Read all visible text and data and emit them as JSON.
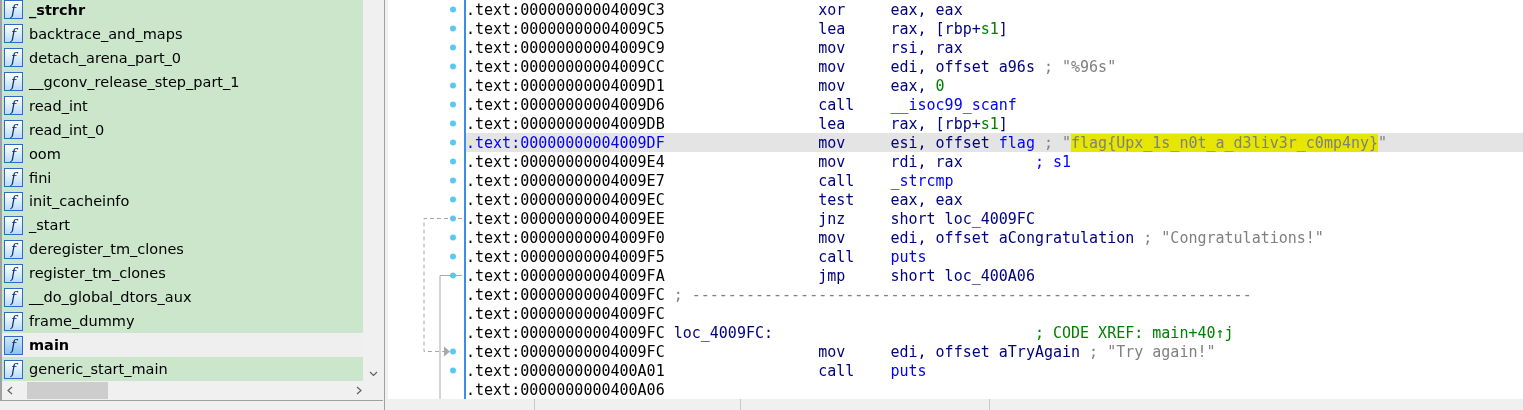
{
  "functions": {
    "items": [
      {
        "icon": "f",
        "name": "_strchr",
        "bold": true,
        "selected": false
      },
      {
        "icon": "f",
        "name": "backtrace_and_maps",
        "bold": false,
        "selected": false
      },
      {
        "icon": "f",
        "name": "detach_arena_part_0",
        "bold": false,
        "selected": false
      },
      {
        "icon": "f",
        "name": "__gconv_release_step_part_1",
        "bold": false,
        "selected": false
      },
      {
        "icon": "f",
        "name": "read_int",
        "bold": false,
        "selected": false
      },
      {
        "icon": "f",
        "name": "read_int_0",
        "bold": false,
        "selected": false
      },
      {
        "icon": "f",
        "name": "oom",
        "bold": false,
        "selected": false
      },
      {
        "icon": "f",
        "name": "fini",
        "bold": false,
        "selected": false
      },
      {
        "icon": "f",
        "name": "init_cacheinfo",
        "bold": false,
        "selected": false
      },
      {
        "icon": "f",
        "name": "_start",
        "bold": false,
        "selected": false
      },
      {
        "icon": "f",
        "name": "deregister_tm_clones",
        "bold": false,
        "selected": false
      },
      {
        "icon": "f",
        "name": "register_tm_clones",
        "bold": false,
        "selected": false
      },
      {
        "icon": "f",
        "name": "__do_global_dtors_aux",
        "bold": false,
        "selected": false
      },
      {
        "icon": "f",
        "name": "frame_dummy",
        "bold": false,
        "selected": false
      },
      {
        "icon": "f",
        "name": "main",
        "bold": true,
        "selected": true
      },
      {
        "icon": "f",
        "name": "generic_start_main",
        "bold": false,
        "selected": false
      }
    ]
  },
  "disassembly": {
    "lines": [
      {
        "kind": "code",
        "address": ".text:00000000004009C3",
        "selected": false,
        "mnemonic": "xor",
        "operands": [
          {
            "kind": "reg",
            "text": "eax, eax"
          }
        ]
      },
      {
        "kind": "code",
        "address": ".text:00000000004009C5",
        "selected": false,
        "mnemonic": "lea",
        "operands": [
          {
            "kind": "reg",
            "text": "rax, [rbp+"
          },
          {
            "kind": "num",
            "text": "s1"
          },
          {
            "kind": "reg",
            "text": "]"
          }
        ]
      },
      {
        "kind": "code",
        "address": ".text:00000000004009C9",
        "selected": false,
        "mnemonic": "mov",
        "operands": [
          {
            "kind": "reg",
            "text": "rsi, rax"
          }
        ]
      },
      {
        "kind": "code",
        "address": ".text:00000000004009CC",
        "selected": false,
        "mnemonic": "mov",
        "operands": [
          {
            "kind": "reg",
            "text": "edi, offset a96s"
          }
        ],
        "comment": [
          {
            "kind": "str",
            "text": "; \"%96s\""
          }
        ]
      },
      {
        "kind": "code",
        "address": ".text:00000000004009D1",
        "selected": false,
        "mnemonic": "mov",
        "operands": [
          {
            "kind": "reg",
            "text": "eax, "
          },
          {
            "kind": "num",
            "text": "0"
          }
        ]
      },
      {
        "kind": "code",
        "address": ".text:00000000004009D6",
        "selected": false,
        "mnemonic": "call",
        "operands": [
          {
            "kind": "name",
            "text": "__isoc99_scanf"
          }
        ]
      },
      {
        "kind": "code",
        "address": ".text:00000000004009DB",
        "selected": false,
        "mnemonic": "lea",
        "operands": [
          {
            "kind": "reg",
            "text": "rax, [rbp+"
          },
          {
            "kind": "num",
            "text": "s1"
          },
          {
            "kind": "reg",
            "text": "]"
          }
        ]
      },
      {
        "kind": "code",
        "address": ".text:00000000004009DF",
        "selected": true,
        "mnemonic": "mov",
        "operands": [
          {
            "kind": "reg",
            "text": "esi, offset "
          },
          {
            "kind": "name",
            "text": "flag"
          }
        ],
        "comment": [
          {
            "kind": "str",
            "text": "; \""
          },
          {
            "kind": "hl",
            "text": "flag{Upx_1s_n0t_a_d3liv3r_c0mp4ny}"
          },
          {
            "kind": "str",
            "text": "\""
          }
        ]
      },
      {
        "kind": "code",
        "address": ".text:00000000004009E4",
        "selected": false,
        "mnemonic": "mov",
        "operands": [
          {
            "kind": "reg",
            "text": "rdi, rax"
          }
        ],
        "comment": [
          {
            "kind": "comment",
            "text": "; s1"
          }
        ]
      },
      {
        "kind": "code",
        "address": ".text:00000000004009E7",
        "selected": false,
        "mnemonic": "call",
        "operands": [
          {
            "kind": "name",
            "text": "_strcmp"
          }
        ]
      },
      {
        "kind": "code",
        "address": ".text:00000000004009EC",
        "selected": false,
        "mnemonic": "test",
        "operands": [
          {
            "kind": "reg",
            "text": "eax, eax"
          }
        ]
      },
      {
        "kind": "code",
        "address": ".text:00000000004009EE",
        "selected": false,
        "mnemonic": "jnz",
        "operands": [
          {
            "kind": "reg",
            "text": "short loc_4009FC"
          }
        ]
      },
      {
        "kind": "code",
        "address": ".text:00000000004009F0",
        "selected": false,
        "mnemonic": "mov",
        "operands": [
          {
            "kind": "reg",
            "text": "edi, offset aCongratulation"
          }
        ],
        "comment": [
          {
            "kind": "str",
            "text": "; \"Congratulations!\""
          }
        ]
      },
      {
        "kind": "code",
        "address": ".text:00000000004009F5",
        "selected": false,
        "mnemonic": "call",
        "operands": [
          {
            "kind": "name",
            "text": "puts"
          }
        ]
      },
      {
        "kind": "code",
        "address": ".text:00000000004009FA",
        "selected": false,
        "mnemonic": "jmp",
        "operands": [
          {
            "kind": "reg",
            "text": "short loc_400A06"
          }
        ]
      },
      {
        "kind": "separator",
        "address": ".text:00000000004009FC",
        "selected": false,
        "text": "; --------------------------------------------------------------"
      },
      {
        "kind": "blank",
        "address": ".text:00000000004009FC",
        "selected": false
      },
      {
        "kind": "label",
        "address": ".text:00000000004009FC",
        "selected": false,
        "label": "loc_4009FC:",
        "comment": [
          {
            "kind": "xref",
            "text": "; CODE XREF: main+40↑j"
          }
        ]
      },
      {
        "kind": "code",
        "address": ".text:00000000004009FC",
        "selected": false,
        "mnemonic": "mov",
        "operands": [
          {
            "kind": "reg",
            "text": "edi, offset aTryAgain"
          }
        ],
        "comment": [
          {
            "kind": "str",
            "text": "; \"Try again!\""
          }
        ]
      },
      {
        "kind": "code",
        "address": ".text:0000000000400A01",
        "selected": false,
        "mnemonic": "call",
        "operands": [
          {
            "kind": "name",
            "text": "puts"
          }
        ]
      },
      {
        "kind": "blank",
        "address": ".text:0000000000400A06",
        "selected": false
      }
    ]
  }
}
